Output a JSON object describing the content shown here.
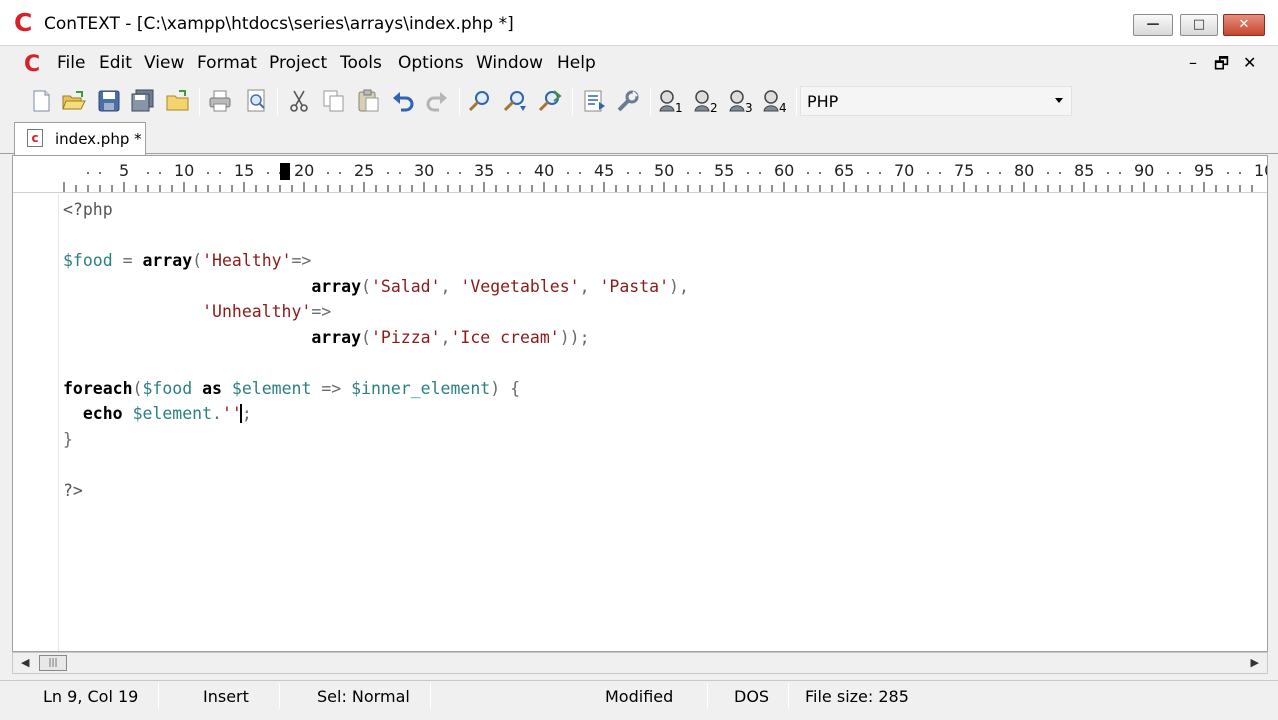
{
  "window": {
    "title": "ConTEXT - [C:\\xampp\\htdocs\\series\\arrays\\index.php *]",
    "minimize_label": "—",
    "maximize_label": "□",
    "close_label": "✕"
  },
  "menu": {
    "items": [
      "File",
      "Edit",
      "View",
      "Format",
      "Project",
      "Tools",
      "Options",
      "Window",
      "Help"
    ],
    "mdi_minimize": "–",
    "mdi_restore": "🗗",
    "mdi_close": "✕"
  },
  "toolbar": {
    "buttons": [
      "new-icon",
      "open-icon",
      "save-icon",
      "save-all-icon",
      "open-folder-icon",
      "print-icon",
      "print-preview-icon",
      "cut-icon",
      "copy-icon",
      "paste-icon",
      "undo-icon",
      "redo-icon",
      "find-icon",
      "find-next-icon",
      "replace-icon",
      "export-icon",
      "tools-icon",
      "user-command-1-icon",
      "user-command-2-icon",
      "user-command-3-icon",
      "user-command-4-icon"
    ],
    "highlighter": "PHP"
  },
  "tabs": [
    {
      "label": "index.php *"
    }
  ],
  "ruler": {
    "labels": [
      "5",
      "10",
      "15",
      "20",
      "25",
      "30",
      "35",
      "40",
      "45",
      "50",
      "55",
      "60",
      "65",
      "70",
      "75",
      "80",
      "85",
      "90",
      "95",
      "10"
    ]
  },
  "editor": {
    "lines": [
      "<?php",
      "",
      "$food = array('Healthy'=>",
      "                         array('Salad', 'Vegetables', 'Pasta'),",
      "              'Unhealthy'=>",
      "                         array('Pizza','Ice cream'));",
      "",
      "foreach($food as $element => $inner_element) {",
      "  echo $element.'';",
      "}",
      "",
      "?>"
    ]
  },
  "status": {
    "position": "Ln 9, Col 19",
    "mode": "Insert",
    "selection": "Sel: Normal",
    "modified": "Modified",
    "line_endings": "DOS",
    "file_size": "File size: 285"
  }
}
